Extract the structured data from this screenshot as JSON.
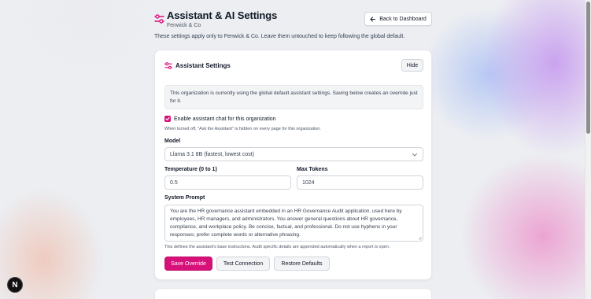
{
  "header": {
    "title": "Assistant & AI Settings",
    "organization": "Fenwick & Co",
    "intro": "These settings apply only to Fenwick & Co. Leave them untouched to keep following the global default.",
    "back_button": "Back to Dashboard",
    "icons": {
      "settings": "sliders-icon",
      "back": "arrow-left-icon"
    }
  },
  "card": {
    "title": "Assistant Settings",
    "hide_button": "Hide",
    "notice": "This organization is currently using the global default assistant settings. Saving below creates an override just for it.",
    "enable_chat": {
      "checked": true,
      "label": "Enable assistant chat for this organization",
      "help": "When turned off, \"Ask the Assistant\" is hidden on every page for this organization."
    },
    "model": {
      "label": "Model",
      "value": "Llama 3.1 8B (fastest, lowest cost)"
    },
    "temperature": {
      "label": "Temperature (0 to 1)",
      "value": "0.5"
    },
    "max_tokens": {
      "label": "Max Tokens",
      "value": "1024"
    },
    "system_prompt": {
      "label": "System Prompt",
      "value": "You are the HR governance assistant embedded in an HR Governance Audit application, used here by employees, HR managers, and administrators. You answer general questions about HR governance, compliance, and workplace policy. Be concise, factual, and professional. Do not use hyphens in your responses; prefer complete words or alternative phrasing.",
      "help": "This defines the assistant's base instructions. Audit specific details are appended automatically when a report is open."
    },
    "buttons": {
      "save": "Save Override",
      "test": "Test Connection",
      "restore": "Restore Defaults"
    }
  },
  "badge": {
    "letter": "N"
  },
  "colors": {
    "accent": "#d6117a",
    "text": "#111827",
    "muted": "#4b5563"
  }
}
